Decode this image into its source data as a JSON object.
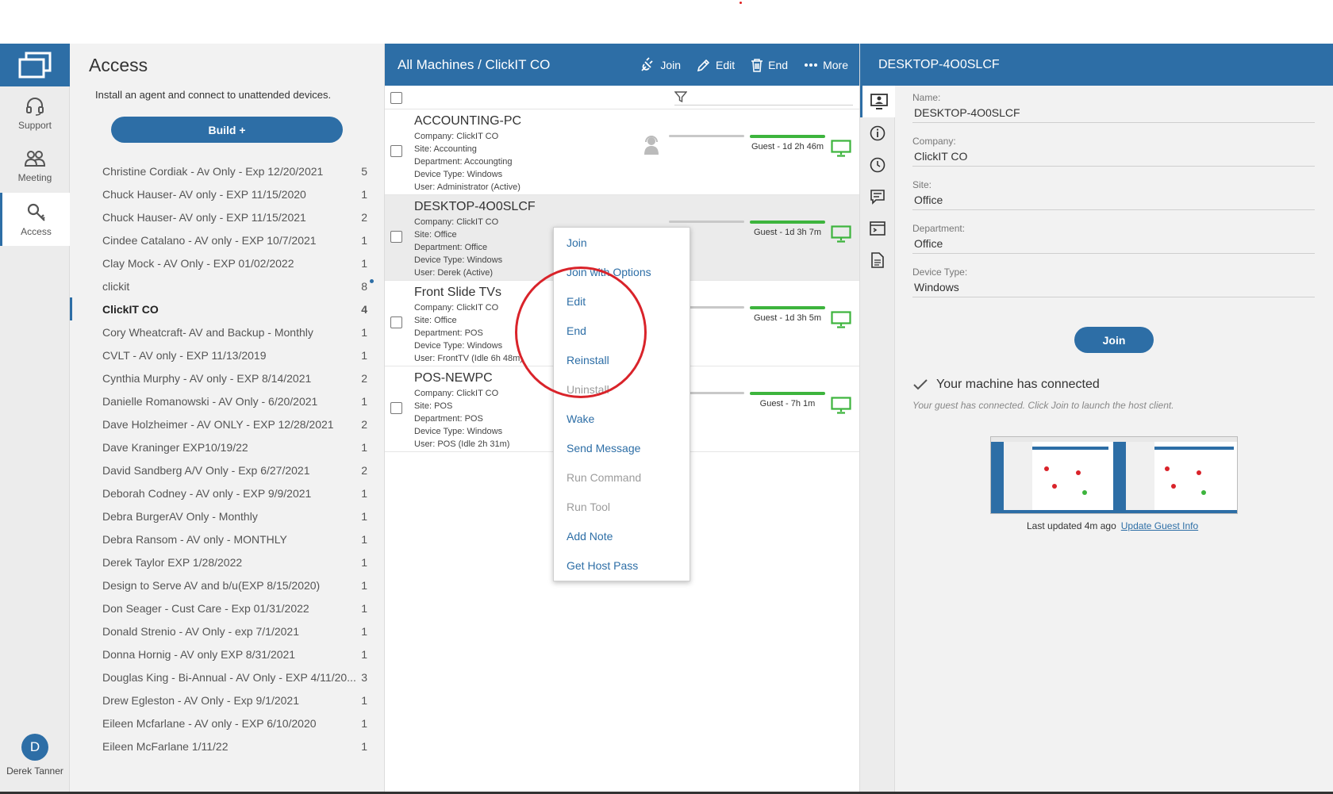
{
  "left_nav": {
    "items": [
      {
        "label": "Support",
        "icon": "headset-icon"
      },
      {
        "label": "Meeting",
        "icon": "people-icon"
      },
      {
        "label": "Access",
        "icon": "key-icon"
      }
    ],
    "user": {
      "initial": "D",
      "name": "Derek Tanner"
    }
  },
  "group_panel": {
    "title": "Access",
    "subtitle": "Install an agent and connect to unattended devices.",
    "build_label": "Build +",
    "groups": [
      {
        "name": "Christine Cordiak - Av Only - Exp 12/20/2021",
        "count": "5"
      },
      {
        "name": "Chuck Hauser- AV only - EXP 11/15/2020",
        "count": "1"
      },
      {
        "name": "Chuck Hauser- AV only - EXP 11/15/2021",
        "count": "2"
      },
      {
        "name": "Cindee Catalano - AV only - EXP 10/7/2021",
        "count": "1"
      },
      {
        "name": "Clay Mock - AV Only - EXP 01/02/2022",
        "count": "1"
      },
      {
        "name": "clickit",
        "count": "8"
      },
      {
        "name": "ClickIT CO",
        "count": "4"
      },
      {
        "name": "Cory Wheatcraft- AV and Backup - Monthly",
        "count": "1"
      },
      {
        "name": "CVLT - AV only - EXP 11/13/2019",
        "count": "1"
      },
      {
        "name": "Cynthia Murphy - AV only - EXP 8/14/2021",
        "count": "2"
      },
      {
        "name": "Danielle Romanowski - AV Only - 6/20/2021",
        "count": "1"
      },
      {
        "name": "Dave Holzheimer - AV ONLY - EXP 12/28/2021",
        "count": "2"
      },
      {
        "name": "Dave Kraninger EXP10/19/22",
        "count": "1"
      },
      {
        "name": "David Sandberg A/V Only - Exp 6/27/2021",
        "count": "2"
      },
      {
        "name": "Deborah Codney - AV only - EXP 9/9/2021",
        "count": "1"
      },
      {
        "name": "Debra BurgerAV Only - Monthly",
        "count": "1"
      },
      {
        "name": "Debra Ransom - AV only - MONTHLY",
        "count": "1"
      },
      {
        "name": "Derek Taylor EXP 1/28/2022",
        "count": "1"
      },
      {
        "name": "Design to Serve AV and b/u(EXP 8/15/2020)",
        "count": "1"
      },
      {
        "name": "Don Seager - Cust Care - Exp 01/31/2022",
        "count": "1"
      },
      {
        "name": "Donald Strenio - AV Only - exp 7/1/2021",
        "count": "1"
      },
      {
        "name": "Donna Hornig - AV only EXP 8/31/2021",
        "count": "1"
      },
      {
        "name": "Douglas King - Bi-Annual - AV Only - EXP 4/11/20...",
        "count": "3"
      },
      {
        "name": "Drew Egleston - AV Only - Exp 9/1/2021",
        "count": "1"
      },
      {
        "name": "Eileen Mcfarlane - AV only - EXP 6/10/2020",
        "count": "1"
      },
      {
        "name": "Eileen McFarlane 1/11/22",
        "count": "1"
      }
    ]
  },
  "machines": {
    "title": "All Machines / ClickIT CO",
    "toolbar": {
      "join": "Join",
      "edit": "Edit",
      "end": "End",
      "more": "More"
    },
    "rows": [
      {
        "name": "ACCOUNTING-PC",
        "company": "Company: ClickIT CO",
        "site": "Site: Accounting",
        "department": "Department: Accoungting",
        "device_type": "Device Type: Windows",
        "user": "User: Administrator (Active)",
        "guest": "Guest - 1d 2h 46m"
      },
      {
        "name": "DESKTOP-4O0SLCF",
        "company": "Company: ClickIT CO",
        "site": "Site: Office",
        "department": "Department: Office",
        "device_type": "Device Type: Windows",
        "user": "User: Derek (Active)",
        "guest": "Guest - 1d 3h 7m"
      },
      {
        "name": "Front Slide TVs",
        "company": "Company: ClickIT CO",
        "site": "Site: Office",
        "department": "Department: POS",
        "device_type": "Device Type: Windows",
        "user": "User: FrontTV (Idle 6h 48m)",
        "guest": "Guest - 1d 3h 5m"
      },
      {
        "name": "POS-NEWPC",
        "company": "Company: ClickIT CO",
        "site": "Site: POS",
        "department": "Department: POS",
        "device_type": "Device Type: Windows",
        "user": "User: POS (Idle 2h 31m)",
        "guest": "Guest - 7h 1m"
      }
    ]
  },
  "context_menu": {
    "items": [
      {
        "label": "Join",
        "enabled": true
      },
      {
        "label": "Join with Options",
        "enabled": true
      },
      {
        "label": "Edit",
        "enabled": true
      },
      {
        "label": "End",
        "enabled": true
      },
      {
        "label": "Reinstall",
        "enabled": true
      },
      {
        "label": "Uninstall",
        "enabled": false
      },
      {
        "label": "Wake",
        "enabled": true
      },
      {
        "label": "Send Message",
        "enabled": true
      },
      {
        "label": "Run Command",
        "enabled": false
      },
      {
        "label": "Run Tool",
        "enabled": false
      },
      {
        "label": "Add Note",
        "enabled": true
      },
      {
        "label": "Get Host Pass",
        "enabled": true
      }
    ]
  },
  "details": {
    "header": "DESKTOP-4O0SLCF",
    "fields": [
      {
        "label": "Name:",
        "value": "DESKTOP-4O0SLCF"
      },
      {
        "label": "Company:",
        "value": "ClickIT CO"
      },
      {
        "label": "Site:",
        "value": "Office"
      },
      {
        "label": "Department:",
        "value": "Office"
      },
      {
        "label": "Device Type:",
        "value": "Windows"
      }
    ],
    "join_label": "Join",
    "connected_title": "Your machine has connected",
    "connected_sub": "Your guest has connected. Click Join to launch the host client.",
    "last_updated": "Last updated 4m ago",
    "update_link": "Update Guest Info"
  },
  "colors": {
    "accent": "#2d6ea6",
    "online_green": "#3db43d",
    "highlight_red": "#d9232a"
  }
}
